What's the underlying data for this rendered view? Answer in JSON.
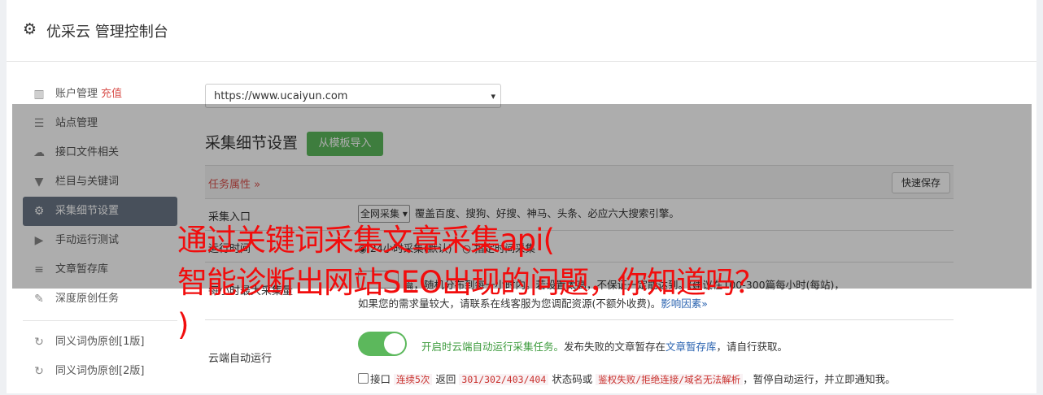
{
  "header": {
    "title": "优采云 管理控制台",
    "icon": "gear-icon"
  },
  "sidebar": {
    "items": [
      {
        "label": "账户管理",
        "badge": "充值",
        "icon": "bar-chart-icon"
      },
      {
        "label": "站点管理",
        "icon": "server-icon"
      },
      {
        "label": "接口文件相关",
        "icon": "cloud-upload-icon"
      },
      {
        "label": "栏目与关键词",
        "icon": "filter-icon"
      },
      {
        "label": "采集细节设置",
        "icon": "gears-icon",
        "active": true
      },
      {
        "label": "手动运行测试",
        "icon": "play-circle-icon"
      },
      {
        "label": "文章暂存库",
        "icon": "database-icon"
      },
      {
        "label": "深度原创任务",
        "icon": "edit-icon"
      },
      {
        "label": "同义词伪原创[1版]",
        "icon": "refresh-icon"
      },
      {
        "label": "同义词伪原创[2版]",
        "icon": "refresh-icon"
      }
    ]
  },
  "main": {
    "site_select": "https://www.ucaiyun.com",
    "section_title": "采集细节设置",
    "import_button": "从模板导入",
    "task_attr": "任务属性 »",
    "quick_save": "快速保存",
    "rows": {
      "entry": {
        "label": "采集入口",
        "select": "全网采集",
        "desc": "覆盖百度、搜狗、好搜、神马、头条、必应六大搜索引擎。"
      },
      "time": {
        "label": "运行时间",
        "option_a": "24小时采集(默认)",
        "option_b": "指定时间采集"
      },
      "limit": {
        "label": "每小时最大采集量",
        "line1": "篇，随机分布到每一小时内。若设置太高，不保证一定能达到。(建议在100-300篇每小时(每站)，",
        "line2": "如果您的需求量较大，请联系在线客服为您调配资源(不额外收费)。",
        "link": "影响因素»"
      },
      "cloud": {
        "label": "云端自动运行",
        "desc_green": "开启时云端自动运行采集任务。",
        "desc_mid": "发布失败的文章暂存在",
        "desc_link": "文章暂存库",
        "desc_end": "，请自行获取。",
        "chk_label": "接口",
        "code1": "连续5次",
        "mid1": "返回",
        "code2": "301/302/403/404",
        "mid2": "状态码或",
        "code3": "鉴权失败/拒绝连接/域名无法解析",
        "tail": "，暂停自动运行，并立即通知我。"
      }
    }
  },
  "overlay": {
    "line1": "通过关键词采集文章采集api(",
    "line2": "智能诊断出网站SEO出现的问题，你知道吗？",
    "line3": ")"
  }
}
